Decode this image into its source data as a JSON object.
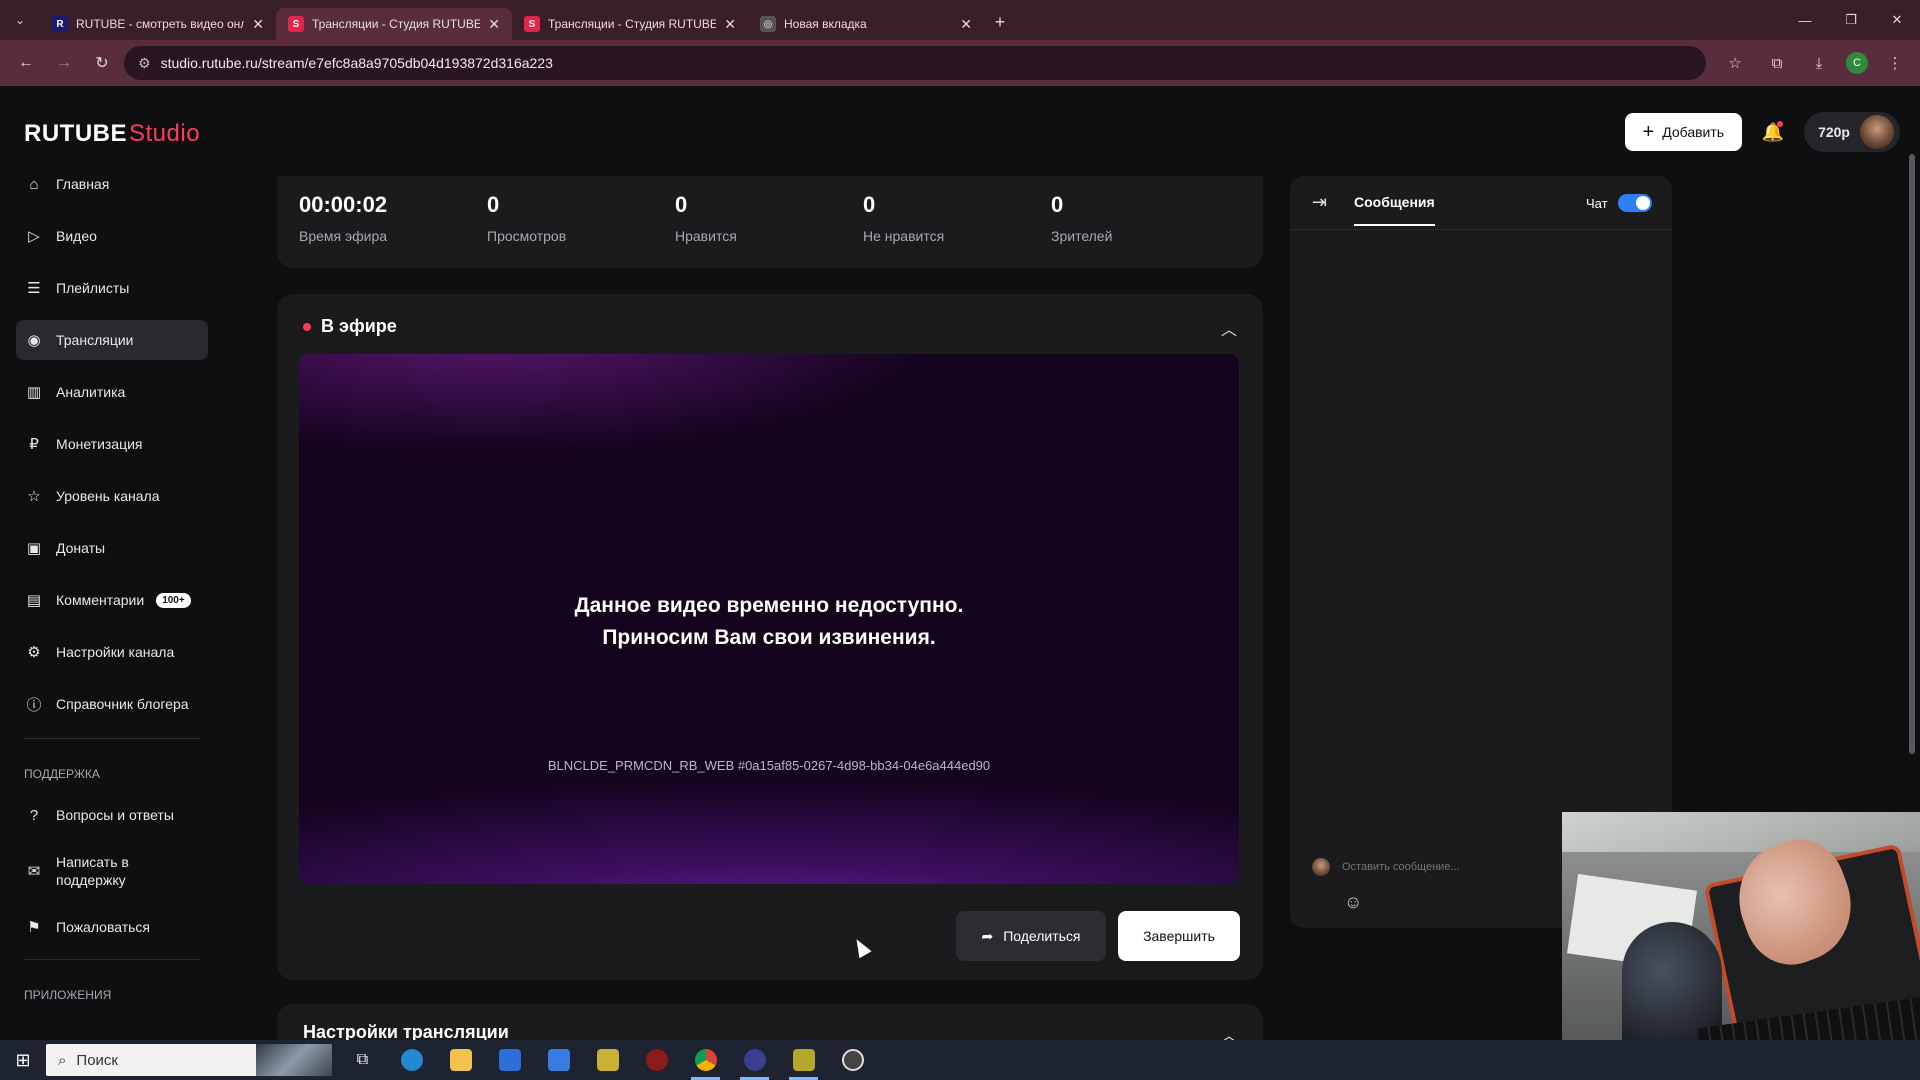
{
  "browser": {
    "tabs": [
      {
        "label": "RUTUBE - смотреть видео онл",
        "favicon": "R",
        "favicon_color": "#1a1a6e",
        "active": false
      },
      {
        "label": "Трансляции - Студия RUTUBE",
        "favicon": "S",
        "favicon_color": "#e4244a",
        "active": true
      },
      {
        "label": "Трансляции - Студия RUTUBE",
        "favicon": "S",
        "favicon_color": "#e4244a",
        "active": false
      },
      {
        "label": "Новая вкладка",
        "favicon": "◎",
        "favicon_color": "#555",
        "active": false
      }
    ],
    "url": "studio.rutube.ru/stream/e7efc8a8a9705db04d193872d316a223",
    "profile_initial": "C"
  },
  "header": {
    "logo_main": "RUTUBE",
    "logo_sub": "Studio",
    "add_label": "Добавить",
    "quality": "720p"
  },
  "sidebar": {
    "items": [
      {
        "label": "Главная",
        "icon": "home-icon",
        "glyph": "⌂"
      },
      {
        "label": "Видео",
        "icon": "video-icon",
        "glyph": "▷"
      },
      {
        "label": "Плейлисты",
        "icon": "playlist-icon",
        "glyph": "☰"
      },
      {
        "label": "Трансляции",
        "icon": "broadcast-icon",
        "glyph": "◉"
      },
      {
        "label": "Аналитика",
        "icon": "analytics-icon",
        "glyph": "▥"
      },
      {
        "label": "Монетизация",
        "icon": "ruble-icon",
        "glyph": "₽"
      },
      {
        "label": "Уровень канала",
        "icon": "star-icon",
        "glyph": "☆"
      },
      {
        "label": "Донаты",
        "icon": "wallet-icon",
        "glyph": "▣"
      },
      {
        "label": "Комментарии",
        "icon": "comment-icon",
        "glyph": "▤",
        "badge": "100+"
      },
      {
        "label": "Настройки канала",
        "icon": "gear-icon",
        "glyph": "⚙"
      },
      {
        "label": "Справочник блогера",
        "icon": "info-icon",
        "glyph": "ⓘ"
      }
    ],
    "support_heading": "ПОДДЕРЖКА",
    "support_items": [
      {
        "label": "Вопросы и ответы",
        "icon": "question-icon",
        "glyph": "?"
      },
      {
        "label": "Написать в поддержку",
        "icon": "mail-icon",
        "glyph": "✉"
      },
      {
        "label": "Пожаловаться",
        "icon": "flag-icon",
        "glyph": "⚑"
      }
    ],
    "apps_heading": "ПРИЛОЖЕНИЯ"
  },
  "stats": [
    {
      "value": "00:00:02",
      "label": "Время эфира"
    },
    {
      "value": "0",
      "label": "Просмотров"
    },
    {
      "value": "0",
      "label": "Нравится"
    },
    {
      "value": "0",
      "label": "Не нравится"
    },
    {
      "value": "0",
      "label": "Зрителей"
    }
  ],
  "live": {
    "title": "В эфире",
    "error_line1": "Данное видео временно недоступно.",
    "error_line2": "Приносим Вам свои извинения.",
    "error_code": "BLNCLDE_PRMCDN_RB_WEB #0a15af85-0267-4d98-bb34-04e6a444ed90",
    "share_label": "Поделиться",
    "finish_label": "Завершить"
  },
  "settings": {
    "title": "Настройки трансляции"
  },
  "chat": {
    "tab_label": "Сообщения",
    "toggle_label": "Чат",
    "toggle_on": true,
    "input_placeholder": "Оставить сообщение..."
  },
  "taskbar": {
    "search_label": "Поиск"
  }
}
